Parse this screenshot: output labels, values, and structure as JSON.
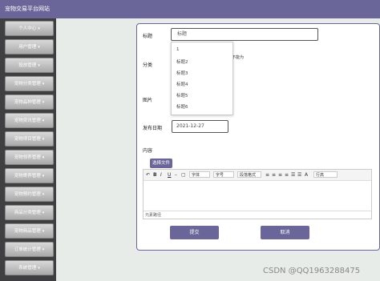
{
  "header": {
    "site_title": "宠物交易平台网站"
  },
  "sidebar": {
    "items": [
      {
        "label": "个人中心"
      },
      {
        "label": "用户管理"
      },
      {
        "label": "投放管理"
      },
      {
        "label": "宠物分类管理"
      },
      {
        "label": "宠物品种管理"
      },
      {
        "label": "宠物资讯管理"
      },
      {
        "label": "宠物项目管理"
      },
      {
        "label": "宠物领养管理"
      },
      {
        "label": "宠物寄养管理"
      },
      {
        "label": "宠物预约管理"
      },
      {
        "label": "商品分类管理"
      },
      {
        "label": "宠物商品管理"
      },
      {
        "label": "订单统计管理"
      },
      {
        "label": "系统管理"
      }
    ]
  },
  "form": {
    "title_label": "标题",
    "title_value": "标题",
    "category_label": "分类",
    "image_label": "图片",
    "date_label": "发布日期",
    "date_value": "2021-12-27",
    "content_label": "内容",
    "side_note": "不能为",
    "dropdown_options": [
      "1",
      "标题2",
      "标题3",
      "标题4",
      "标题5",
      "标题6"
    ],
    "choose_file_label": "选择文件",
    "submit_label": "提交",
    "cancel_label": "取消"
  },
  "editor": {
    "font_family_value": "字体",
    "font_size_value": "字号",
    "style_value": "段落格式",
    "line_height_value": "行高",
    "status_text": "元素路径"
  },
  "watermark": "CSDN @QQ1963288475",
  "colors": {
    "accent": "#6a6699",
    "sidebar_bg": "#3f3f42",
    "main_bg": "#e7ece9"
  }
}
